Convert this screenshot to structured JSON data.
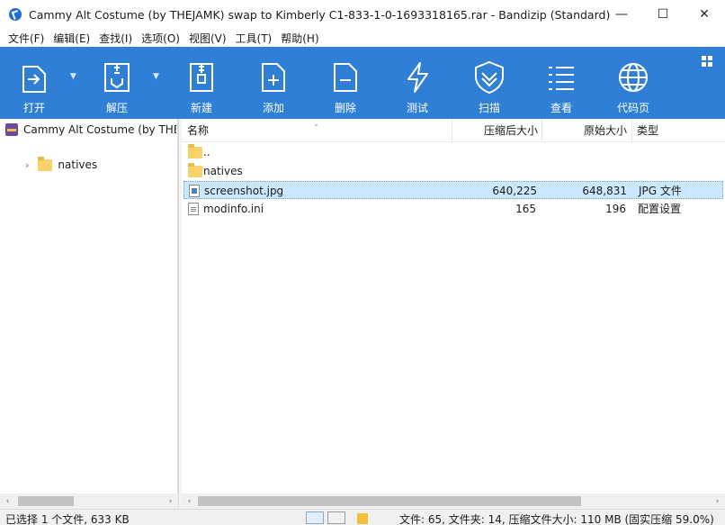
{
  "window": {
    "title": "Cammy Alt Costume (by THEJAMK) swap to Kimberly C1-833-1-0-1693318165.rar - Bandizip (Standard)",
    "controls": {
      "minimize": "—",
      "maximize": "☐",
      "close": "✕"
    }
  },
  "menu": [
    "文件(F)",
    "编辑(E)",
    "查找(I)",
    "选项(O)",
    "视图(V)",
    "工具(T)",
    "帮助(H)"
  ],
  "toolbar": {
    "background": "#2f7fd6",
    "buttons": [
      {
        "label": "打开",
        "icon": "open-icon",
        "has_dropdown": true
      },
      {
        "label": "解压",
        "icon": "extract-icon",
        "has_dropdown": true
      },
      {
        "label": "新建",
        "icon": "new-archive-icon"
      },
      {
        "label": "添加",
        "icon": "add-icon"
      },
      {
        "label": "删除",
        "icon": "delete-icon"
      },
      {
        "label": "测试",
        "icon": "test-icon"
      },
      {
        "label": "扫描",
        "icon": "scan-shield-icon"
      },
      {
        "label": "查看",
        "icon": "view-list-icon"
      },
      {
        "label": "代码页",
        "icon": "codepage-globe-icon"
      }
    ]
  },
  "tree": {
    "root": "Cammy Alt Costume (by THE..",
    "children": [
      {
        "label": "natives",
        "expand": "›"
      }
    ]
  },
  "list": {
    "columns": {
      "name": "名称",
      "compressed": "压缩后大小",
      "original": "原始大小",
      "type": "类型"
    },
    "rows": [
      {
        "name": "..",
        "icon": "folder-icon",
        "compressed": "",
        "original": "",
        "type": "",
        "selected": false
      },
      {
        "name": "natives",
        "icon": "folder-icon",
        "compressed": "",
        "original": "",
        "type": "",
        "selected": false
      },
      {
        "name": "screenshot.jpg",
        "icon": "image-file-icon",
        "compressed": "640,225",
        "original": "648,831",
        "type": "JPG 文件",
        "selected": true
      },
      {
        "name": "modinfo.ini",
        "icon": "ini-file-icon",
        "compressed": "165",
        "original": "196",
        "type": "配置设置",
        "selected": false
      }
    ]
  },
  "status": {
    "left": "已选择 1 个文件, 633 KB",
    "right": "文件: 65, 文件夹: 14, 压缩文件大小: 110 MB (固实压缩 59.0%)"
  },
  "scroll_arrows": {
    "left": "‹",
    "right": "›"
  },
  "header_sort_caret": "⌄"
}
